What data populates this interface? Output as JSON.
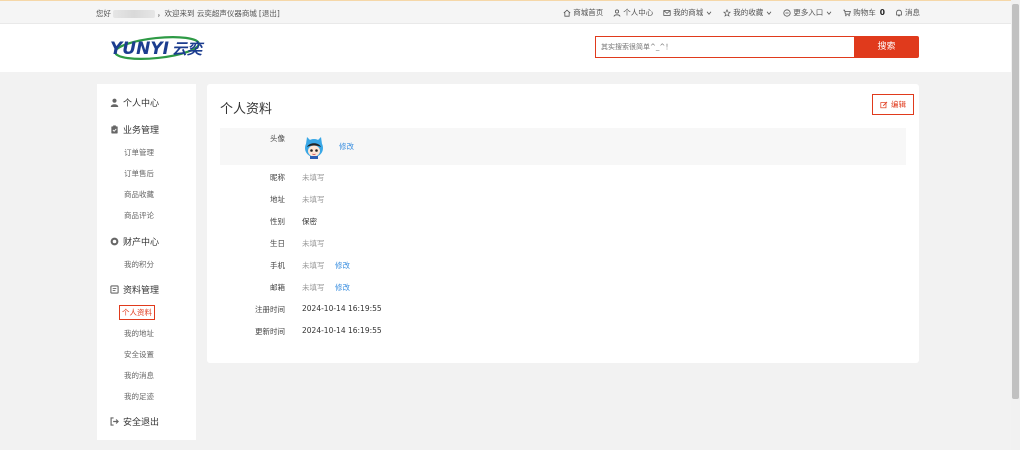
{
  "topbar": {
    "greeting": "您好",
    "welcome": "，欢迎来到 云奕超声仪器商城",
    "logout": "[退出]",
    "links": [
      {
        "label": "商城首页",
        "icon": "home-icon"
      },
      {
        "label": "个人中心",
        "icon": "user-icon"
      },
      {
        "label": "我的商城",
        "icon": "mail-icon"
      },
      {
        "label": "我的收藏",
        "icon": "star-icon"
      },
      {
        "label": "更多入口",
        "icon": "circle-plus-icon"
      },
      {
        "label": "购物车",
        "icon": "cart-icon"
      },
      {
        "label": "消息",
        "icon": "bell-icon"
      }
    ],
    "cart_count": "0"
  },
  "header": {
    "logo_text_en": "YUNYI",
    "logo_text_cn": "云奕",
    "search_placeholder": "其实搜索很简单^_^！",
    "search_button": "搜索"
  },
  "sidebar": {
    "groups": [
      {
        "label": "个人中心",
        "icon": "user-icon"
      },
      {
        "label": "业务管理",
        "icon": "clipboard-icon"
      },
      {
        "label": "财产中心",
        "icon": "coin-icon"
      },
      {
        "label": "资料管理",
        "icon": "profile-card-icon"
      },
      {
        "label": "安全退出",
        "icon": "logout-icon"
      }
    ],
    "business_items": [
      "订单管理",
      "订单售后",
      "商品收藏",
      "商品评论"
    ],
    "asset_items": [
      "我的积分"
    ],
    "profile_items": [
      "个人资料",
      "我的地址",
      "安全设置",
      "我的消息",
      "我的足迹"
    ]
  },
  "main": {
    "title": "个人资料",
    "edit_button": "编辑",
    "fields": {
      "avatar_label": "头像",
      "avatar_edit": "修改",
      "nickname_label": "昵称",
      "nickname_value": "未填写",
      "address_label": "地址",
      "address_value": "未填写",
      "gender_label": "性别",
      "gender_value": "保密",
      "birthday_label": "生日",
      "birthday_value": "未填写",
      "phone_label": "手机",
      "phone_value": "未填写",
      "phone_edit": "修改",
      "email_label": "邮箱",
      "email_value": "未填写",
      "email_edit": "修改",
      "register_label": "注册时间",
      "register_value": "2024-10-14 16:19:55",
      "update_label": "更新时间",
      "update_value": "2024-10-14 16:19:55"
    }
  },
  "colors": {
    "accent": "#e03a1c",
    "link": "#3b8fe0",
    "logo_blue": "#1c3d8f",
    "logo_green": "#2e9a45"
  }
}
